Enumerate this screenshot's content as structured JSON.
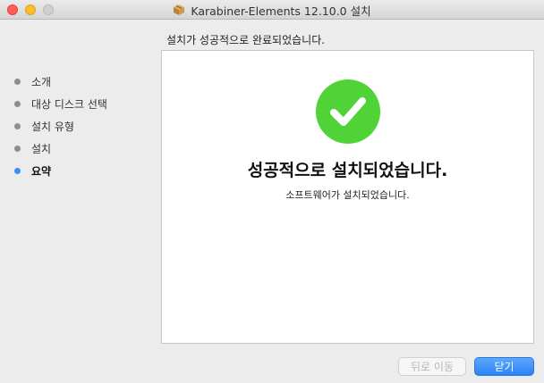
{
  "window": {
    "title": "Karabiner-Elements 12.10.0 설치"
  },
  "heading": "설치가 성공적으로 완료되었습니다.",
  "steps": [
    {
      "label": "소개",
      "active": false
    },
    {
      "label": "대상 디스크 선택",
      "active": false
    },
    {
      "label": "설치 유형",
      "active": false
    },
    {
      "label": "설치",
      "active": false
    },
    {
      "label": "요약",
      "active": true
    }
  ],
  "panel": {
    "icon": "checkmark-circle-icon",
    "title": "성공적으로 설치되었습니다.",
    "subtitle": "소프트웨어가 설치되었습니다."
  },
  "buttons": {
    "back_label": "뒤로 이동",
    "close_label": "닫기"
  },
  "colors": {
    "accent": "#3a8ef6",
    "success": "#4fd337"
  }
}
